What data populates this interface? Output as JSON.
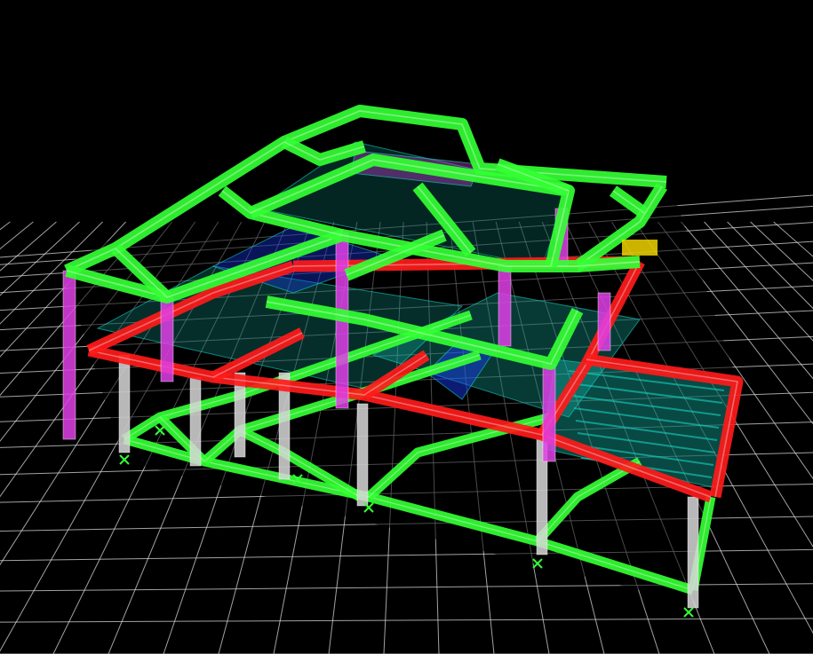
{
  "scene": {
    "colors": {
      "background": "#000000",
      "grid": "#d8d8d8",
      "beam_upper": "#33ff33",
      "beam_ground": "#33ff33",
      "beam_mid": "#ff1a1a",
      "column_upper": "#e040e8",
      "column_lower": "#d8d8d8",
      "slab_fill": "#18d0c0",
      "slab_blue": "#1a3cff",
      "accent_yellow": "#ffe000",
      "support": "#33ff33"
    }
  }
}
